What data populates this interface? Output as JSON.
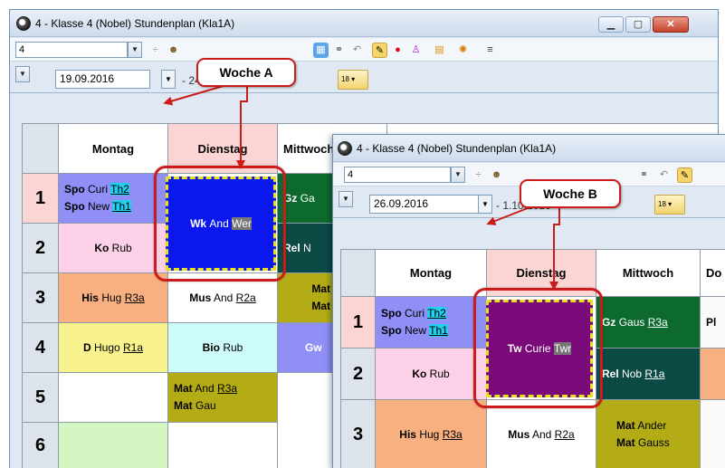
{
  "window1": {
    "title": "4 - Klasse 4 (Nobel)  Stundenplan  (Kla1A)",
    "class_value": "4",
    "date_from": "19.09.2016",
    "date_to": "- 24.09.2016",
    "days": [
      "Montag",
      "Dienstag",
      "Mittwoch"
    ],
    "periods": [
      "1",
      "2",
      "3",
      "4",
      "5",
      "6"
    ],
    "mon": {
      "p1_line1": [
        "Spo",
        "Curi",
        "Th2"
      ],
      "p1_line2": [
        "Spo",
        "New",
        "Th1"
      ],
      "p2": [
        "Ko",
        "Rub"
      ],
      "p3": [
        "His",
        "Hug",
        "R3a"
      ],
      "p4": [
        "D",
        "Hugo",
        "R1a"
      ]
    },
    "tue": {
      "p12": [
        "Wk",
        "And",
        "Wer"
      ],
      "p3": [
        "Mus",
        "And",
        "R2a"
      ],
      "p4": [
        "Bio",
        "Rub"
      ],
      "p5_line1": [
        "Mat",
        "And",
        "R3a"
      ],
      "p5_line2": [
        "Mat",
        "Gau"
      ]
    },
    "wed": {
      "p1": [
        "Gz",
        "Ga"
      ],
      "p2": [
        "Rel",
        "N"
      ],
      "p3_line1": "Mat",
      "p3_line2": "Mat",
      "p4": "Gw"
    }
  },
  "window2": {
    "title": "4 - Klasse 4 (Nobel)  Stundenplan  (Kla1A)",
    "class_value": "4",
    "date_from": "26.09.2016",
    "date_to": "- 1.10.2016",
    "days": [
      "Montag",
      "Dienstag",
      "Mittwoch",
      "Do"
    ],
    "periods": [
      "1",
      "2",
      "3"
    ],
    "mon": {
      "p1_line1": [
        "Spo",
        "Curi",
        "Th2"
      ],
      "p1_line2": [
        "Spo",
        "New",
        "Th1"
      ],
      "p2": [
        "Ko",
        "Rub"
      ],
      "p3": [
        "His",
        "Hug",
        "R3a"
      ]
    },
    "tue": {
      "p12": [
        "Tw",
        "Curie",
        "Twr"
      ],
      "p3": [
        "Mus",
        "And",
        "R2a"
      ]
    },
    "wed": {
      "p1": [
        "Gz",
        "Gaus",
        "R3a"
      ],
      "p2": [
        "Rel",
        "Nob",
        "R1a"
      ],
      "p3_line1": [
        "Mat",
        "Ander"
      ],
      "p3_line2": [
        "Mat",
        "Gauss"
      ]
    },
    "thu": {
      "p1": "Pl"
    }
  },
  "callouts": {
    "week_a": "Woche A",
    "week_b": "Woche B"
  },
  "colors": {
    "spo": "#8f8ff5",
    "ko": "#fcd0e6",
    "his": "#f8b080",
    "d": "#f8f28d",
    "mus": "#ffffff",
    "bio": "#cdfbfb",
    "mat": "#b4ac16",
    "gz": "#0d6a2e",
    "rel": "#0c4a45",
    "wk": "#0a17ee",
    "tw": "#7a0a7a",
    "ring": "#cc1b1b"
  }
}
